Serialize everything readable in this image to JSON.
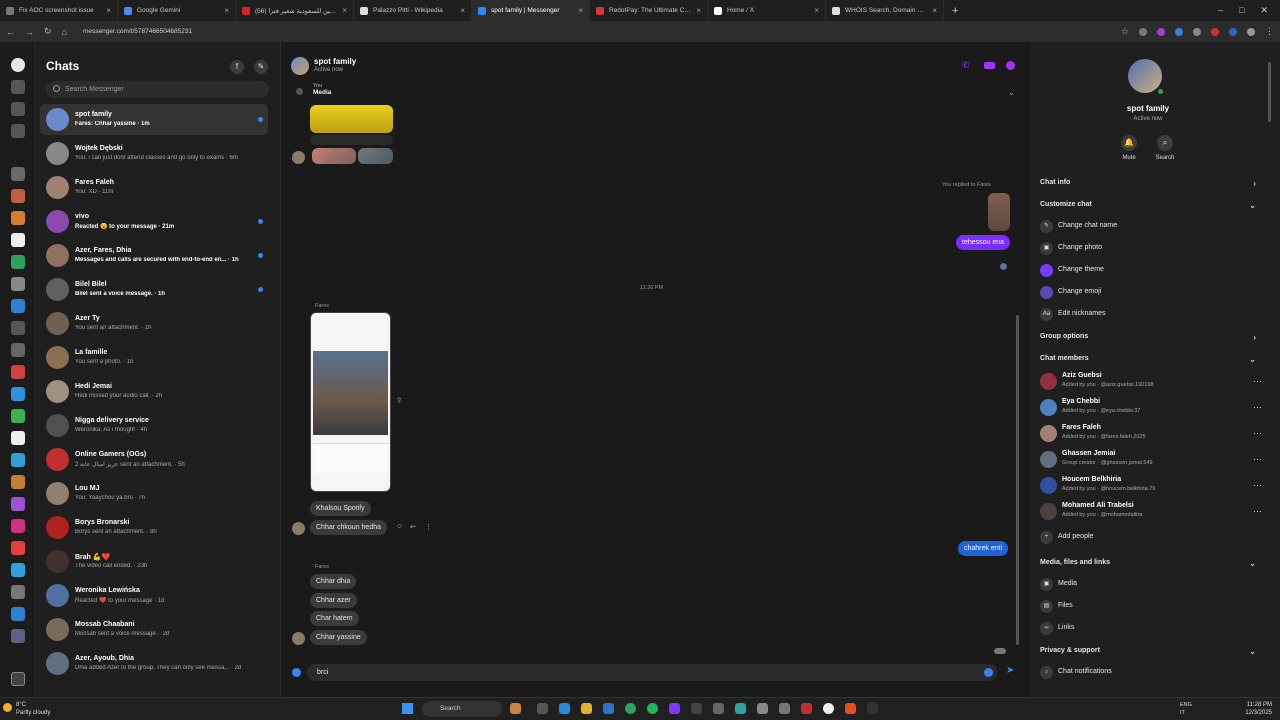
{
  "browser": {
    "tabs": [
      {
        "title": "Fix AOC screenshot issue",
        "color": "#777777"
      },
      {
        "title": "Google Gemini",
        "color": "#4a8af4"
      },
      {
        "title": "(56) رادمين للسعودية شعير فترا",
        "color": "#e02020"
      },
      {
        "title": "Palazzo Pitti - Wikipedia",
        "color": "#dddddd"
      },
      {
        "title": "spot family | Messenger",
        "color": "#2d88ff",
        "active": true
      },
      {
        "title": "RedotPay: The Ultimate Crypto",
        "color": "#e03040"
      },
      {
        "title": "Home / X",
        "color": "#ffffff"
      },
      {
        "title": "WHOIS Search, Domain Name",
        "color": "#dddddd"
      }
    ],
    "url": "messenger.com/t/5787466504685231"
  },
  "chats": {
    "title": "Chats",
    "search_placeholder": "Search Messenger",
    "items": [
      {
        "name": "spot family",
        "preview": "Fares: Chhar yassine · 1m",
        "bold": true,
        "unread": true,
        "color": "#6b8ac9"
      },
      {
        "name": "Wojtek Dębski",
        "preview": "You: i can just dont attend classes and go only to exams · 6m",
        "color": "#888888"
      },
      {
        "name": "Fares Faleh",
        "preview": "You: XD · 11m",
        "color": "#a08070"
      },
      {
        "name": "vivo",
        "preview": "Reacted 😮 to your message · 21m",
        "bold": true,
        "unread": true,
        "color": "#8a4ab0"
      },
      {
        "name": "Azer, Fares, Dhia",
        "preview": "Messages and calls are secured with end-to-end en... · 1h",
        "bold": true,
        "unread": true,
        "color": "#907060"
      },
      {
        "name": "Bilel Bilel",
        "preview": "Bilel sent a voice message. · 1h",
        "bold": true,
        "unread": true,
        "color": "#606060"
      },
      {
        "name": "Azer Ty",
        "preview": "You sent an attachment. · 1h",
        "color": "#706050"
      },
      {
        "name": "La famille",
        "preview": "You sent a photo. · 1h",
        "color": "#8a7050"
      },
      {
        "name": "Hedi Jemai",
        "preview": "Hedi missed your audio call. · 2h",
        "color": "#a09080"
      },
      {
        "name": "Nigga delivery service",
        "preview": "Weronika: As i thought · 4h",
        "color": "#505050"
      },
      {
        "name": "Online Gamers (OGs)",
        "preview": "عزيز اميال عاية 2 sent an attachment. · 5h",
        "color": "#c03030"
      },
      {
        "name": "Lou MJ",
        "preview": "You: Yaaychou ya bro · 7h",
        "color": "#908070"
      },
      {
        "name": "Borys Bronarski",
        "preview": "Borys sent an attachment. · 8h",
        "color": "#b02020"
      },
      {
        "name": "Brah 💪❤️",
        "preview": "The video call ended. · 23h",
        "color": "#403030"
      },
      {
        "name": "Weronika Lewińska",
        "preview": "Reacted ❤️ to your message · 1d",
        "color": "#5070a0"
      },
      {
        "name": "Mossab Chaabani",
        "preview": "Mossab sent a voice message. · 2d",
        "color": "#7a6a5a"
      },
      {
        "name": "Azer, Ayoub, Dhia",
        "preview": "Dhia added Azer to the group. They can only see messa... · 2d",
        "color": "#607080"
      }
    ]
  },
  "conversation": {
    "name": "spot family",
    "status": "Active now",
    "pinned_label": "You",
    "pinned_title": "Media",
    "replied_label": "You replied to Fares",
    "time_divider": "11:26 PM",
    "sender_fares": "Fares",
    "messages": {
      "out1": "tehessou ena",
      "in_khalsou": "Khalsou Spotify",
      "in_chkoun": "Chhar chkoun hedha",
      "out2": "chahrek enti",
      "in1": "Chhar dhia",
      "in2": "Chhar azer",
      "in3": "Char hatem",
      "in4": "Chhar yassine"
    },
    "composer_value": "brci"
  },
  "info": {
    "name": "spot family",
    "status": "Active now",
    "mute": "Mute",
    "search": "Search",
    "chat_info": "Chat info",
    "customize": "Customize chat",
    "change_name": "Change chat name",
    "change_photo": "Change photo",
    "change_theme": "Change theme",
    "change_emoji": "Change emoji",
    "edit_nicknames": "Edit nicknames",
    "group_options": "Group options",
    "chat_members": "Chat members",
    "members": [
      {
        "name": "Aziz Guebsi",
        "sub": "Added by you · @aziz.guebsi.160198",
        "color": "#903040"
      },
      {
        "name": "Eya Chebbi",
        "sub": "Added by you · @eya.chebbi.37",
        "color": "#5080c0"
      },
      {
        "name": "Fares Faleh",
        "sub": "Added by you · @fares.faleh.2025",
        "color": "#a08070"
      },
      {
        "name": "Ghassen Jemiai",
        "sub": "Group creator · @ghassen.jemai.549",
        "color": "#607080"
      },
      {
        "name": "Houcem Belkhiria",
        "sub": "Added by you · @houcem.belkhiria.79",
        "color": "#3050a0"
      },
      {
        "name": "Mohamed Ali Trabelsi",
        "sub": "Added by you · @mohamedalitra",
        "color": "#504040"
      }
    ],
    "add_people": "Add people",
    "media_files_links": "Media, files and links",
    "media": "Media",
    "files": "Files",
    "links": "Links",
    "privacy": "Privacy & support",
    "notifications": "Chat notifications"
  },
  "taskbar": {
    "temp": "8°C",
    "weather": "Partly cloudy",
    "search": "Search",
    "lang1": "ENG",
    "lang2": "IT",
    "time": "11:28 PM",
    "date": "12/3/2025"
  }
}
